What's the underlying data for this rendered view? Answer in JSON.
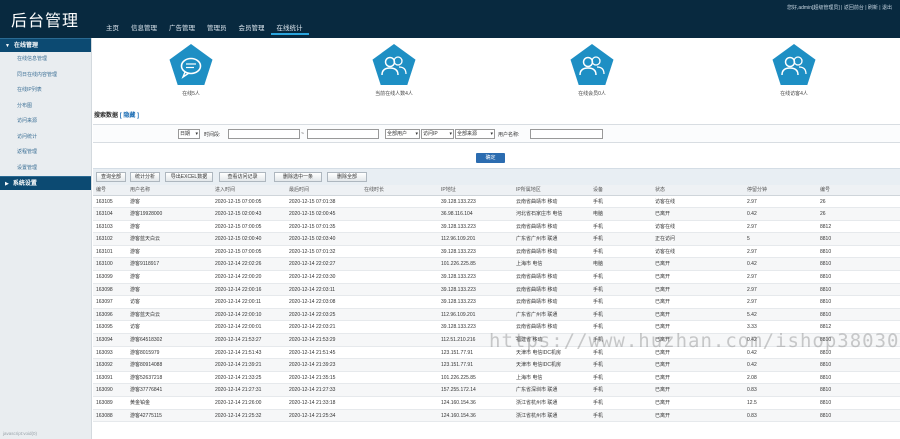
{
  "header": {
    "title": "后台管理",
    "user_info": "您好,admin[超级管理员] | 返回前台 | 刷新 | 退出",
    "nav": [
      "主页",
      "信息管理",
      "广告管理",
      "管理员",
      "会员管理",
      "在线统计"
    ]
  },
  "sidebar": {
    "group1": "在线管理",
    "items": [
      "在线信息管理",
      "同日在线内容管理",
      "在线IP列表",
      "分布图",
      "访问来源",
      "访问统计",
      "返程管理",
      "设置管理"
    ],
    "group2": "系统设置",
    "footer": "javascript:void(0)"
  },
  "stats": [
    {
      "label": "在线5人"
    },
    {
      "label": "当前在线人数4人"
    },
    {
      "label": "在线会员0人"
    },
    {
      "label": "在线访客4人"
    }
  ],
  "filter": {
    "title": "搜索数据",
    "link": "[ 隐藏 ]",
    "time_select": "日期",
    "time_label": "时间段:",
    "dash": "~",
    "type_select": "全部用户",
    "sort_select": "访问IP",
    "desc_select": "全部来源",
    "user_label": "用户名称:",
    "search_button": "确定"
  },
  "toolbar": [
    "查询全部",
    "统计分析",
    "导出EXCEL数据",
    "查看访问记录",
    "删除选中一条",
    "删除全部"
  ],
  "table": {
    "headers": [
      "编号",
      "用户名称",
      "进入时间",
      "最后时间",
      "在线时长",
      "IP地址",
      "IP所属地区",
      "设备",
      "状态",
      "停留分钟",
      "编号"
    ],
    "rows": [
      [
        "163105",
        "游客",
        "2020-12-15 07:00:05",
        "2020-12-15 07:01:38",
        "",
        "39.128.133.223",
        "云南省曲靖市 移动",
        "手机",
        "访客在线",
        "2.97",
        "26"
      ],
      [
        "163104",
        "游客19928000",
        "2020-12-15 02:00:43",
        "2020-12-15 02:00:45",
        "",
        "36.98.116.104",
        "河北省石家庄市 电信",
        "电脑",
        "已离开",
        "0.42",
        "26"
      ],
      [
        "163103",
        "游客",
        "2020-12-15 07:00:05",
        "2020-12-15 07:01:35",
        "",
        "39.128.133.223",
        "云南省曲靖市 移动",
        "手机",
        "访客在线",
        "2.97",
        "8812"
      ],
      [
        "163102",
        "游客蓝天白云",
        "2020-12-15 02:00:40",
        "2020-12-15 02:03:40",
        "",
        "112.96.109.201",
        "广东省广州市 联通",
        "手机",
        "正在访问",
        "5",
        "8810"
      ],
      [
        "163101",
        "游客",
        "2020-12-15 07:00:05",
        "2020-12-15 07:01:32",
        "",
        "39.128.133.223",
        "云南省曲靖市 移动",
        "手机",
        "访客在线",
        "2.97",
        "8810"
      ],
      [
        "163100",
        "游客9118917",
        "2020-12-14 22:02:26",
        "2020-12-14 22:02:27",
        "",
        "101.226.225.85",
        "上海市 电信",
        "电脑",
        "已离开",
        "0.42",
        "8810"
      ],
      [
        "163099",
        "游客",
        "2020-12-14 22:00:20",
        "2020-12-14 22:03:30",
        "",
        "39.128.133.223",
        "云南省曲靖市 移动",
        "手机",
        "已离开",
        "2.97",
        "8810"
      ],
      [
        "163098",
        "游客",
        "2020-12-14 22:00:16",
        "2020-12-14 22:03:11",
        "",
        "39.128.133.223",
        "云南省曲靖市 移动",
        "手机",
        "已离开",
        "2.97",
        "8810"
      ],
      [
        "163097",
        "访客",
        "2020-12-14 22:00:11",
        "2020-12-14 22:03:08",
        "",
        "39.128.133.223",
        "云南省曲靖市 移动",
        "手机",
        "已离开",
        "2.97",
        "8810"
      ],
      [
        "163096",
        "游客蓝天白云",
        "2020-12-14 22:00:10",
        "2020-12-14 22:03:25",
        "",
        "112.96.109.201",
        "广东省广州市 联通",
        "手机",
        "已离开",
        "5.42",
        "8810"
      ],
      [
        "163095",
        "访客",
        "2020-12-14 22:00:01",
        "2020-12-14 22:03:21",
        "",
        "39.128.133.223",
        "云南省曲靖市 移动",
        "手机",
        "已离开",
        "3.33",
        "8812"
      ],
      [
        "163094",
        "游客64518302",
        "2020-12-14 21:53:27",
        "2020-12-14 21:53:29",
        "",
        "112.51.210.216",
        "福建省 移动",
        "手机",
        "已离开",
        "0.42",
        "8810"
      ],
      [
        "163093",
        "游客8015979",
        "2020-12-14 21:51:43",
        "2020-12-14 21:51:45",
        "",
        "123.151.77.91",
        "天津市 电信IDC机房",
        "手机",
        "已离开",
        "0.42",
        "8810"
      ],
      [
        "163092",
        "游客80914088",
        "2020-12-14 21:39:21",
        "2020-12-14 21:39:23",
        "",
        "123.151.77.91",
        "天津市 电信IDC机房",
        "手机",
        "已离开",
        "0.42",
        "8810"
      ],
      [
        "163091",
        "游客52637218",
        "2020-12-14 21:33:25",
        "2020-12-14 21:35:15",
        "",
        "101.226.225.85",
        "上海市 电信",
        "手机",
        "已离开",
        "2.08",
        "8810"
      ],
      [
        "163090",
        "游客37776841",
        "2020-12-14 21:27:31",
        "2020-12-14 21:27:33",
        "",
        "157.255.172.14",
        "广东省深圳市 联通",
        "手机",
        "已离开",
        "0.83",
        "8810"
      ],
      [
        "163089",
        "黄金铂金",
        "2020-12-14 21:26:00",
        "2020-12-14 21:33:18",
        "",
        "124.160.154.36",
        "浙江省杭州市 联通",
        "手机",
        "已离开",
        "12.5",
        "8810"
      ],
      [
        "163088",
        "游客42775115",
        "2020-12-14 21:25:32",
        "2020-12-14 21:25:34",
        "",
        "124.160.154.36",
        "浙江省杭州市 联通",
        "手机",
        "已离开",
        "0.83",
        "8810"
      ]
    ]
  },
  "watermark": "https://www.huzhan.com/ishop38030",
  "colors": {
    "header": "#08293f",
    "sidebar_group": "#0c4a72",
    "accent": "#1e8fc4",
    "button": "#2b6cb0"
  }
}
